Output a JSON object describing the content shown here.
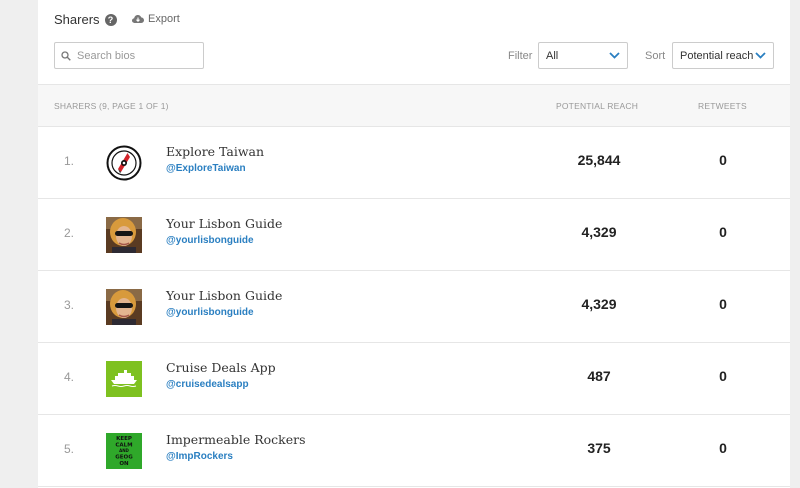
{
  "header": {
    "title": "Sharers",
    "export_label": "Export"
  },
  "search": {
    "placeholder": "Search bios"
  },
  "filter": {
    "label": "Filter",
    "selected": "All"
  },
  "sort": {
    "label": "Sort",
    "selected": "Potential reach"
  },
  "table": {
    "columns": {
      "sharers": "SHARERS (9, PAGE 1 OF 1)",
      "reach": "POTENTIAL REACH",
      "retweets": "RETWEETS"
    },
    "rows": [
      {
        "rank": "1.",
        "name": "Explore Taiwan",
        "handle": "@ExploreTaiwan",
        "reach": "25,844",
        "retweets": "0",
        "avatar": "compass-logo"
      },
      {
        "rank": "2.",
        "name": "Your Lisbon Guide",
        "handle": "@yourlisbonguide",
        "reach": "4,329",
        "retweets": "0",
        "avatar": "person-photo"
      },
      {
        "rank": "3.",
        "name": "Your Lisbon Guide",
        "handle": "@yourlisbonguide",
        "reach": "4,329",
        "retweets": "0",
        "avatar": "person-photo"
      },
      {
        "rank": "4.",
        "name": "Cruise Deals App",
        "handle": "@cruisedealsapp",
        "reach": "487",
        "retweets": "0",
        "avatar": "ship-logo"
      },
      {
        "rank": "5.",
        "name": "Impermeable Rockers",
        "handle": "@ImpRockers",
        "reach": "375",
        "retweets": "0",
        "avatar": "keep-calm-logo",
        "avatar_text": [
          "KEEP",
          "CALM",
          "AND",
          "GEOG",
          "ON"
        ]
      }
    ]
  },
  "colors": {
    "link": "#2a7fc1",
    "chevron": "#2a7fc1",
    "cruise_green": "#7ec120",
    "keep_calm_green": "#2fa82a"
  }
}
